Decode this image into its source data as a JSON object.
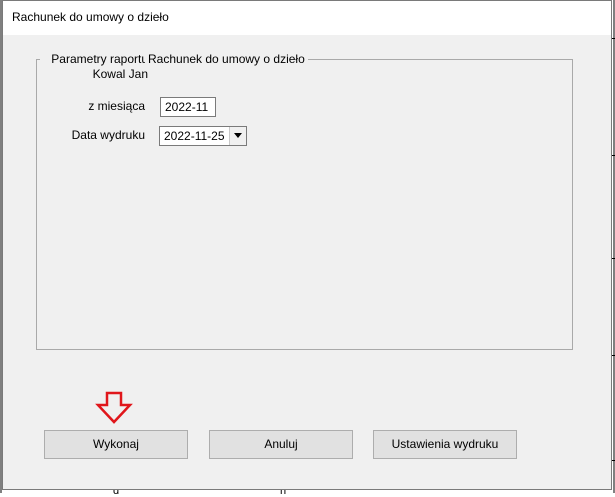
{
  "dialog": {
    "title": "Rachunek do umowy o dzieło"
  },
  "group": {
    "caption_left_line1": "Parametry raportu",
    "caption_left_line2": "Kowal Jan",
    "caption_right": "Rachunek do umowy o dzieło"
  },
  "fields": {
    "month_label": "z miesiąca",
    "month_value": "2022-11",
    "print_date_label": "Data wydruku",
    "print_date_value": "2022-11-25"
  },
  "buttons": {
    "execute": "Wykonaj",
    "cancel": "Anuluj",
    "print_settings": "Ustawienia wydruku"
  },
  "annotation": {
    "arrow_icon": "down-arrow-icon",
    "arrow_color": "#e0161b"
  },
  "background": {
    "frag_bottom_1": "d",
    "frag_bottom_2": "n"
  }
}
